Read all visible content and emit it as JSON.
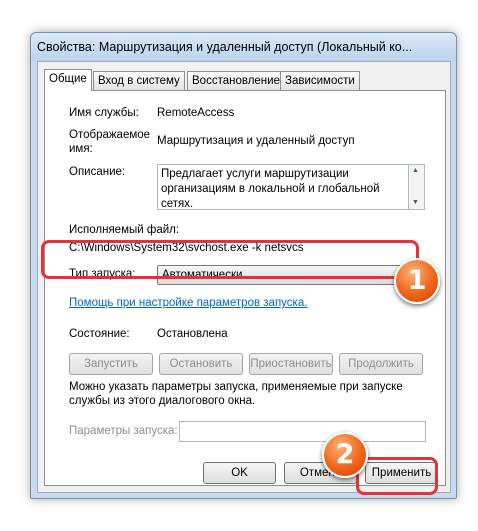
{
  "window": {
    "title": "Свойства: Маршрутизация и удаленный доступ (Локальный ко..."
  },
  "tabs": [
    {
      "label": "Общие",
      "active": true
    },
    {
      "label": "Вход в систему",
      "active": false
    },
    {
      "label": "Восстановление",
      "active": false
    },
    {
      "label": "Зависимости",
      "active": false
    }
  ],
  "general": {
    "service_name_label": "Имя службы:",
    "service_name_value": "RemoteAccess",
    "display_name_label_line1": "Отображаемое",
    "display_name_label_line2": "имя:",
    "display_name_value": "Маршрутизация и удаленный доступ",
    "description_label": "Описание:",
    "description_value": "Предлагает услуги маршрутизации организациям в локальной и глобальной сетях.",
    "exe_label": "Исполняемый файл:",
    "exe_value": "C:\\Windows\\System32\\svchost.exe -k netsvcs",
    "startup_type_label": "Тип запуска:",
    "startup_type_value": "Автоматически",
    "help_link": "Помощь при настройке параметров запуска.",
    "status_label": "Состояние:",
    "status_value": "Остановлена",
    "buttons": {
      "start": "Запустить",
      "stop": "Остановить",
      "pause": "Приостановить",
      "resume": "Продолжить"
    },
    "note": "Можно указать параметры запуска, применяемые при запуске службы из этого диалогового окна.",
    "start_params_label": "Параметры запуска:"
  },
  "footer": {
    "ok": "OK",
    "cancel": "Отмена",
    "apply": "Применить"
  },
  "annotations": {
    "badge1": "1",
    "badge2": "2",
    "highlight_color": "#e4323a",
    "badge_color": "#f06418"
  }
}
